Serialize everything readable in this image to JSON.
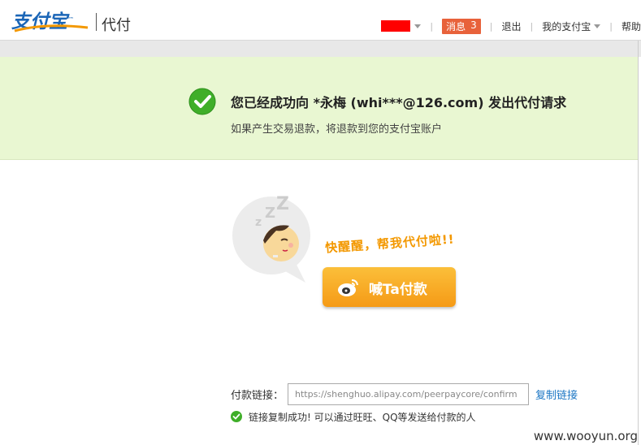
{
  "header": {
    "logo_text": "支付宝",
    "logo_tm": "™",
    "section_title": "代付",
    "nav": {
      "message_label": "消息",
      "message_count": "3",
      "logout": "退出",
      "my_alipay": "我的支付宝",
      "help": "帮助"
    }
  },
  "success": {
    "title": "您已经成功向 *永梅 (whi***@126.com) 发出代付请求",
    "subtitle": "如果产生交易退款，将退款到您的支付宝账户"
  },
  "promo": {
    "wakeup_text": "快醒醒，帮我代付啦!!",
    "share_button": "喊Ta付款"
  },
  "link": {
    "label": "付款链接：",
    "url": "https://shenghuo.alipay.com/peerpaycore/confirm",
    "copy_button": "复制链接",
    "copy_success": "链接复制成功! 可以通过旺旺、QQ等发送给付款的人"
  },
  "watermark": "www.wooyun.org",
  "colors": {
    "brand_blue": "#1b66b7",
    "success_bg": "#e9f7d2",
    "badge": "#e8623b",
    "button_orange": "#f59a16",
    "link_blue": "#1b76c4"
  }
}
